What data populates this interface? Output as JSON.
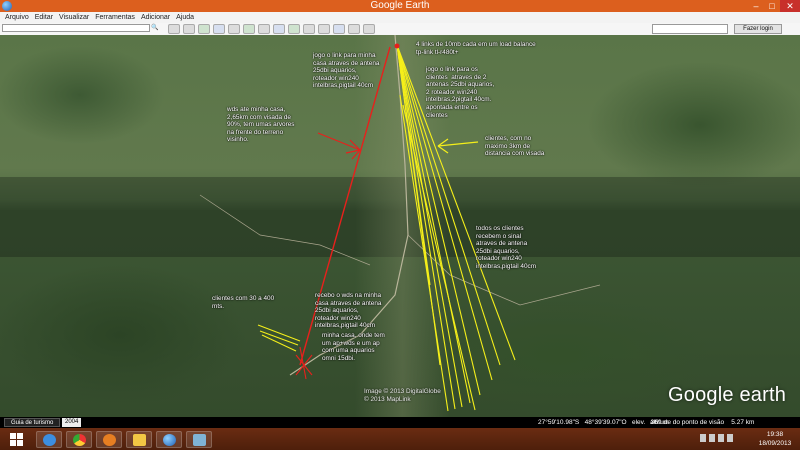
{
  "window": {
    "title": "Google Earth",
    "min_symbol": "–",
    "max_symbol": "□",
    "close_symbol": "✕"
  },
  "menu": {
    "items": [
      "Arquivo",
      "Editar",
      "Visualizar",
      "Ferramentas",
      "Adicionar",
      "Ajuda"
    ]
  },
  "toolbar": {
    "search_placeholder": "",
    "login_label": "Fazer login"
  },
  "annotations": {
    "top_links": "4 links de 10mb cada em um load balance\ntp-link tl-r480t+",
    "link_home": "jogo o link para minha\ncasa atraves de antena\n25dbi aquarios,\nroteador win240\nintelbras,pigtail 40cm",
    "link_clients": "jogo o link para os\nclientes  atraves de 2\nantenas 25dbi aquarios,\n2 roteador win240\nintelbras,2pigtail 40cm.\napontada entre os\nclientes",
    "wds_home": "wds ate minha casa,\n2,65km com visada de\n90%, tem umas arvores\nna frente do terreno\nvisinho.",
    "clients_range": "clientes, com no\nmaximo 3km de\ndistancia com visada",
    "all_clients": "todos os clientes\nrecebem o sinal\natraves de antena\n25dbi aquarios,\nroteador win240\nintelbras,pigtail 40cm",
    "clients_near": "clientes com 30 a 400\nmts.",
    "receive_wds": "recebo o wds na minha\ncasa atraves de antena\n25dbi aquarios,\nroteador win240\nintelbras,pigtail 40cm",
    "my_house": "minha casa, onde tem\num ap+wds e um ap\ncom uma aquarios\nomni 15dbi."
  },
  "imagery_credit": {
    "line1": "Image © 2013 DigitalGlobe",
    "line2": "© 2013 MapLink"
  },
  "logo": {
    "brand": "Google",
    "product": "earth"
  },
  "statusbar": {
    "guide_tab": "Guia de turismo",
    "imagery_year": "2004",
    "coordinates": "27°59'10.98\"S   48°39'39.07\"O   elev.   369 m",
    "eye_altitude": "altitude do ponto de visão    5.27 km"
  },
  "clock": {
    "time": "19:38",
    "date": "18/09/2013"
  },
  "colors": {
    "titlebar": "#dc5f1e",
    "client_lines": "#f5ef1a",
    "wds_line": "#e8201c",
    "annotation_text": "#ffffff"
  }
}
